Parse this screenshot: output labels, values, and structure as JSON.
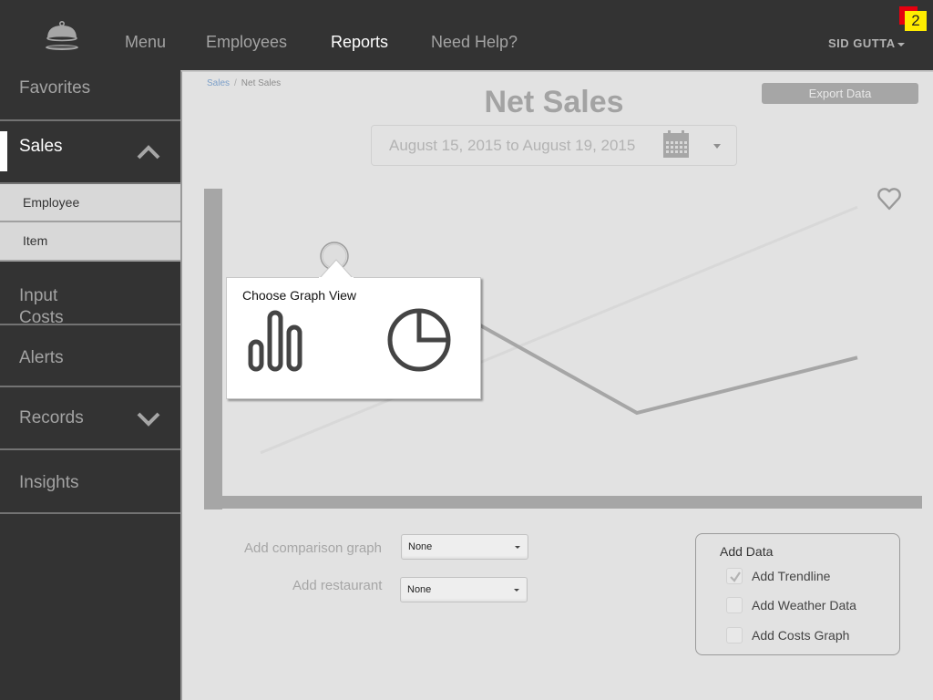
{
  "header": {
    "logo": "cloche-icon",
    "nav": [
      {
        "label": "Menu",
        "active": false
      },
      {
        "label": "Employees",
        "active": false
      },
      {
        "label": "Reports",
        "active": true
      },
      {
        "label": "Need Help?",
        "active": false
      }
    ],
    "user_name": "SID GUTTA",
    "notification_count": "2",
    "colors": {
      "badge_red": "#e5000f",
      "badge_yellow": "#ffec00"
    }
  },
  "sidebar": {
    "items": [
      {
        "label": "Favorites"
      },
      {
        "label": "Sales",
        "active": true,
        "expanded": true,
        "icon": "chevron-up-icon"
      },
      {
        "label": "Input Costs"
      },
      {
        "label": "Alerts"
      },
      {
        "label": "Records",
        "expanded": false,
        "icon": "chevron-down-icon"
      },
      {
        "label": "Insights"
      }
    ],
    "sales_subitems": [
      {
        "label": "Employee"
      },
      {
        "label": "Item"
      }
    ]
  },
  "main": {
    "breadcrumb": {
      "parent": "Sales",
      "separator": "/",
      "current": "Net Sales"
    },
    "title": "Net Sales",
    "export_label": "Export Data",
    "date_range": "August 15, 2015 to August 19, 2015",
    "graph_popup": {
      "title": "Choose Graph View",
      "options": [
        "bar-chart-icon",
        "pie-chart-icon"
      ]
    },
    "comparison": {
      "label": "Add comparison graph",
      "value": "None"
    },
    "restaurant": {
      "label": "Add restaurant",
      "value": "None"
    },
    "add_data": {
      "title": "Add Data",
      "options": [
        {
          "label": "Add Trendline",
          "checked": true
        },
        {
          "label": "Add Weather Data",
          "checked": false
        },
        {
          "label": "Add Costs Graph",
          "checked": false
        }
      ]
    }
  },
  "chart_data": {
    "type": "line",
    "title": "",
    "xlabel": "",
    "ylabel": "",
    "x": [
      0,
      1,
      2,
      3
    ],
    "series": [
      {
        "name": "Net Sales",
        "values": [
          null,
          0.56,
          0.27,
          0.45
        ],
        "color": "#a6a6a6"
      },
      {
        "name": "Trendline",
        "values": [
          0.14,
          null,
          null,
          0.94
        ],
        "color": "#d8d8d8"
      }
    ],
    "ylim": [
      0,
      1
    ],
    "grid": false
  }
}
